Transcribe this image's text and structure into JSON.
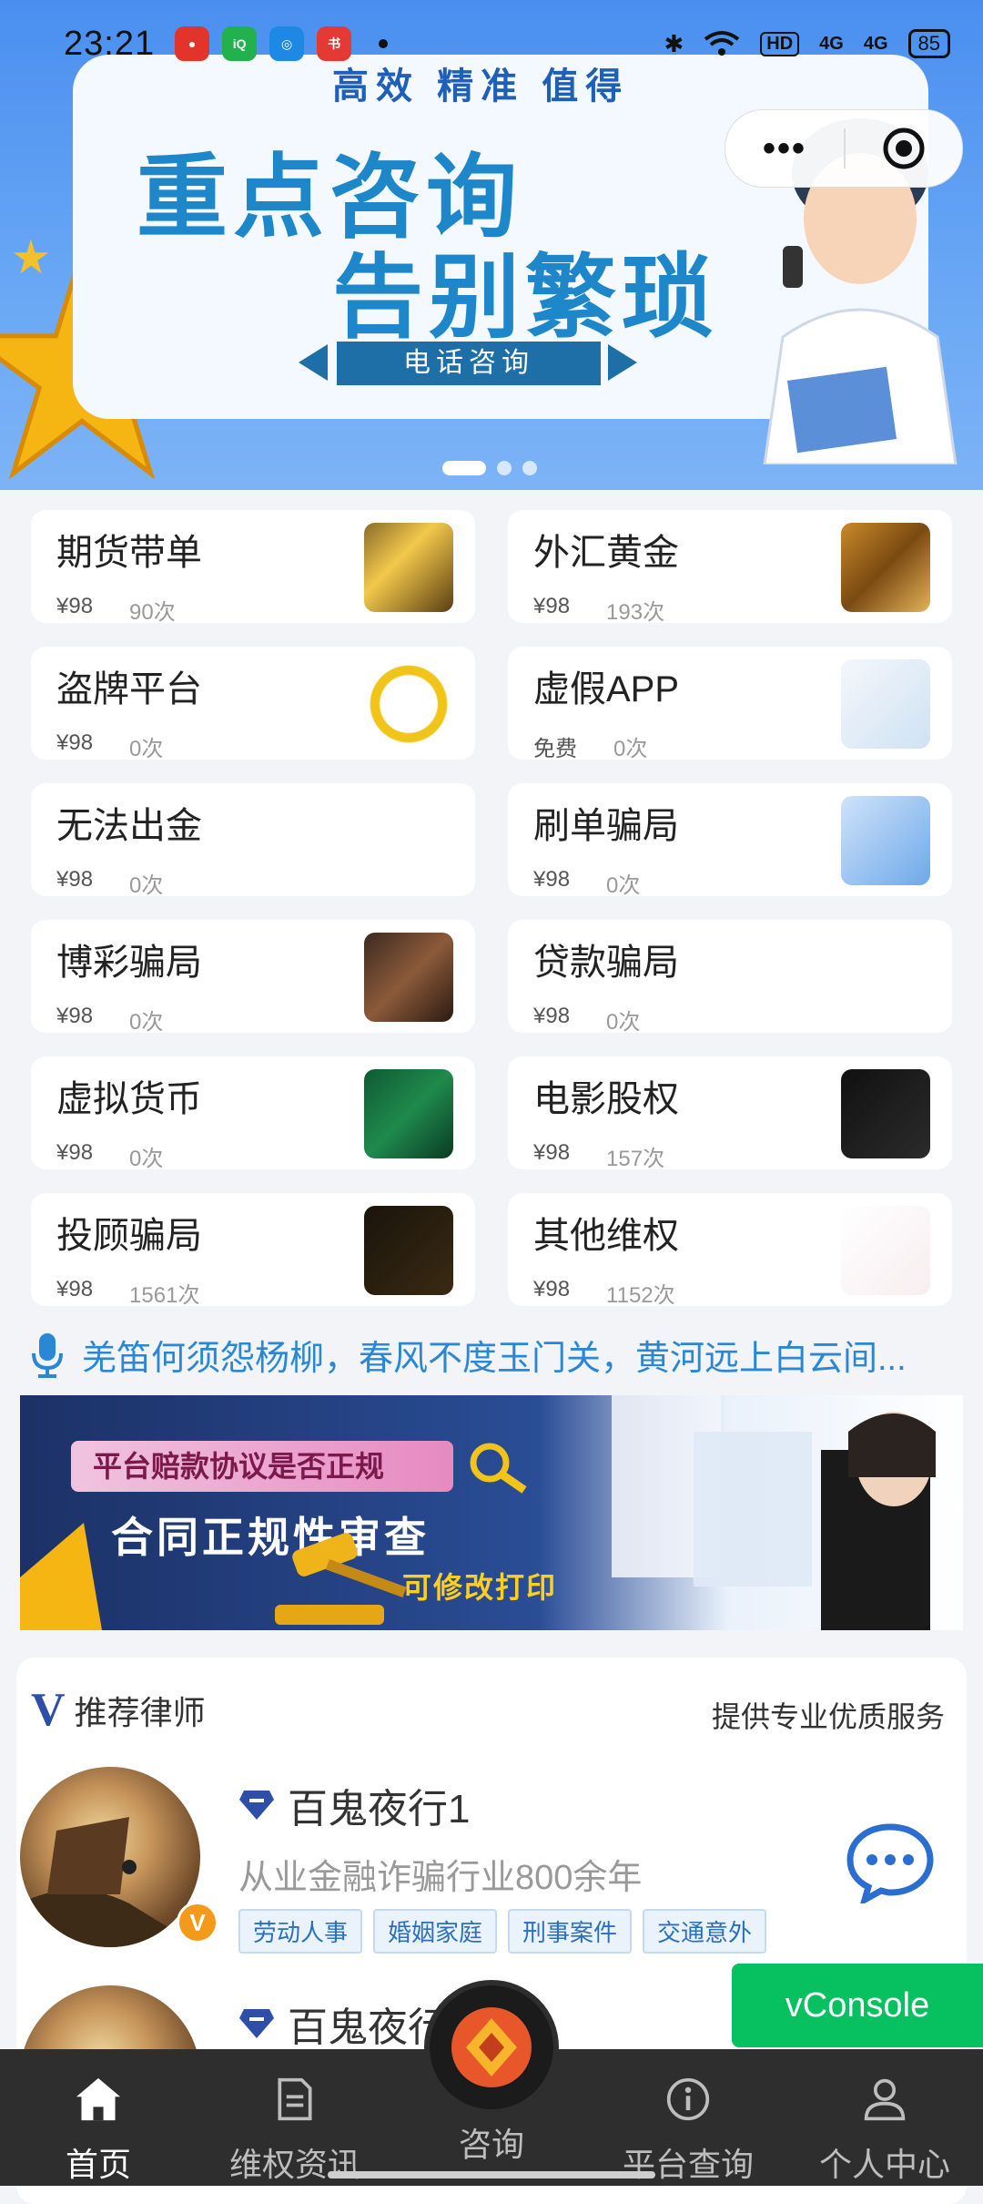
{
  "status_bar": {
    "time": "23:21",
    "network_hd": "HD",
    "network_4g_1": "4G",
    "network_4g_2": "4G",
    "battery": "85"
  },
  "banner": {
    "tagline": "高效 精准 值得",
    "headline_1": "重点咨询",
    "headline_2": "告别繁琐",
    "button": "电话咨询",
    "slides": 3,
    "active_slide": 1
  },
  "capsule": {
    "more": "•••"
  },
  "services": [
    {
      "name": "期货带单",
      "price": "¥98",
      "count": "90次",
      "thumb": "futures"
    },
    {
      "name": "外汇黄金",
      "price": "¥98",
      "count": "193次",
      "thumb": "gold"
    },
    {
      "name": "盗牌平台",
      "price": "¥98",
      "count": "0次",
      "thumb": "badge"
    },
    {
      "name": "虚假APP",
      "price": "免费",
      "count": "0次",
      "thumb": "app"
    },
    {
      "name": "无法出金",
      "price": "¥98",
      "count": "0次",
      "thumb": "yuan"
    },
    {
      "name": "刷单骗局",
      "price": "¥98",
      "count": "0次",
      "thumb": "trap"
    },
    {
      "name": "博彩骗局",
      "price": "¥98",
      "count": "0次",
      "thumb": "gamble"
    },
    {
      "name": "贷款骗局",
      "price": "¥98",
      "count": "0次",
      "thumb": "loan"
    },
    {
      "name": "虚拟货币",
      "price": "¥98",
      "count": "0次",
      "thumb": "coin"
    },
    {
      "name": "电影股权",
      "price": "¥98",
      "count": "157次",
      "thumb": "film"
    },
    {
      "name": "投顾骗局",
      "price": "¥98",
      "count": "1561次",
      "thumb": "invest"
    },
    {
      "name": "其他维权",
      "price": "¥98",
      "count": "1152次",
      "thumb": "other"
    }
  ],
  "notice": {
    "text": "羌笛何须怨杨柳，春风不度玉门关，黄河远上白云间..."
  },
  "ad": {
    "pill": "平台赔款协议是否正规",
    "title": "合同正规性审查",
    "subtitle": "可修改打印"
  },
  "lawyers_section": {
    "badge": "V",
    "title": "推荐律师",
    "subtitle": "提供专业优质服务",
    "items": [
      {
        "name": "百鬼夜行1",
        "desc": "从业金融诈骗行业800余年",
        "badge": "V",
        "tags": [
          "劳动人事",
          "婚姻家庭",
          "刑事案件",
          "交通意外"
        ]
      },
      {
        "name": "百鬼夜行",
        "desc": "",
        "badge": "",
        "tags": []
      }
    ]
  },
  "vconsole": "vConsole",
  "tabbar": [
    {
      "label": "首页",
      "icon": "home-icon",
      "active": true
    },
    {
      "label": "维权资讯",
      "icon": "document-icon",
      "active": false
    },
    {
      "label": "咨询",
      "icon": "consult-logo-icon",
      "active": false
    },
    {
      "label": "平台查询",
      "icon": "info-icon",
      "active": false
    },
    {
      "label": "个人中心",
      "icon": "user-icon",
      "active": false
    }
  ],
  "colors": {
    "accent_blue": "#2a87d5",
    "tag_blue": "#2a6fc0",
    "vconsole_green": "#07c160",
    "tabbar_bg": "#2e2e2e"
  }
}
